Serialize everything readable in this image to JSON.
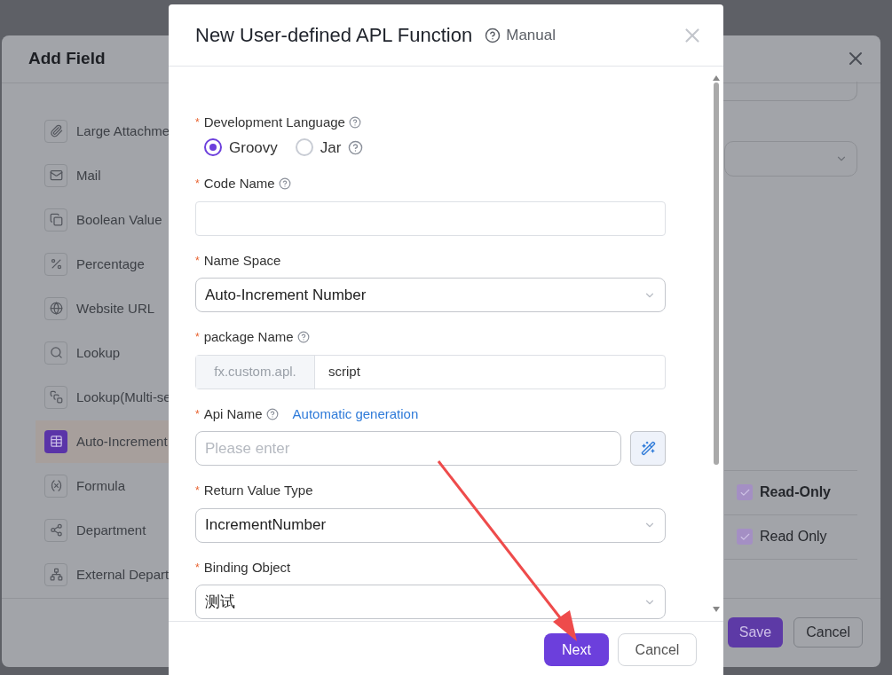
{
  "add_field_dialog": {
    "title": "Add Field",
    "field_types": [
      {
        "label": "Large Attachme",
        "selected": false
      },
      {
        "label": "Mail",
        "selected": false
      },
      {
        "label": "Boolean Value",
        "selected": false
      },
      {
        "label": "Percentage",
        "selected": false
      },
      {
        "label": "Website URL",
        "selected": false
      },
      {
        "label": "Lookup",
        "selected": false
      },
      {
        "label": "Lookup(Multi-se",
        "selected": false
      },
      {
        "label": "Auto-Increment",
        "selected": true
      },
      {
        "label": "Formula",
        "selected": false
      },
      {
        "label": "Department",
        "selected": false
      },
      {
        "label": "External Depart",
        "selected": false
      }
    ],
    "options": [
      {
        "label": "Read-Only",
        "kind": "group",
        "checked": true
      },
      {
        "label": "Read Only",
        "kind": "item",
        "checked": true
      }
    ],
    "buttons": [
      "Save",
      "Cancel"
    ]
  },
  "apl_dialog": {
    "title": "New User-defined APL Function",
    "manual_link": "Manual",
    "fields": [
      {
        "kind": "radio",
        "label": "Development Language",
        "help": true,
        "required_mark": "*",
        "options": [
          {
            "label": "Groovy",
            "selected": true,
            "help": false
          },
          {
            "label": "Jar",
            "selected": false,
            "help": true
          }
        ]
      },
      {
        "kind": "text",
        "label": "Code Name",
        "help": true,
        "required_mark": "*"
      },
      {
        "kind": "select",
        "label": "Name Space",
        "help": false,
        "required_mark": "*",
        "value": "Auto-Increment Number"
      },
      {
        "kind": "prefixed",
        "label": "package Name",
        "help": true,
        "required_mark": "*",
        "prefix": "fx.custom.apl.",
        "value": "script"
      },
      {
        "kind": "generated",
        "label": "Api Name",
        "help": true,
        "required_mark": "*",
        "link": "Automatic generation",
        "placeholder": "Please enter"
      },
      {
        "kind": "select",
        "label": "Return Value Type",
        "help": false,
        "required_mark": "*",
        "value": "IncrementNumber"
      },
      {
        "kind": "select",
        "label": "Binding Object",
        "help": false,
        "required_mark": "*",
        "value": "测试"
      }
    ],
    "buttons": [
      "Next",
      "Cancel"
    ]
  }
}
